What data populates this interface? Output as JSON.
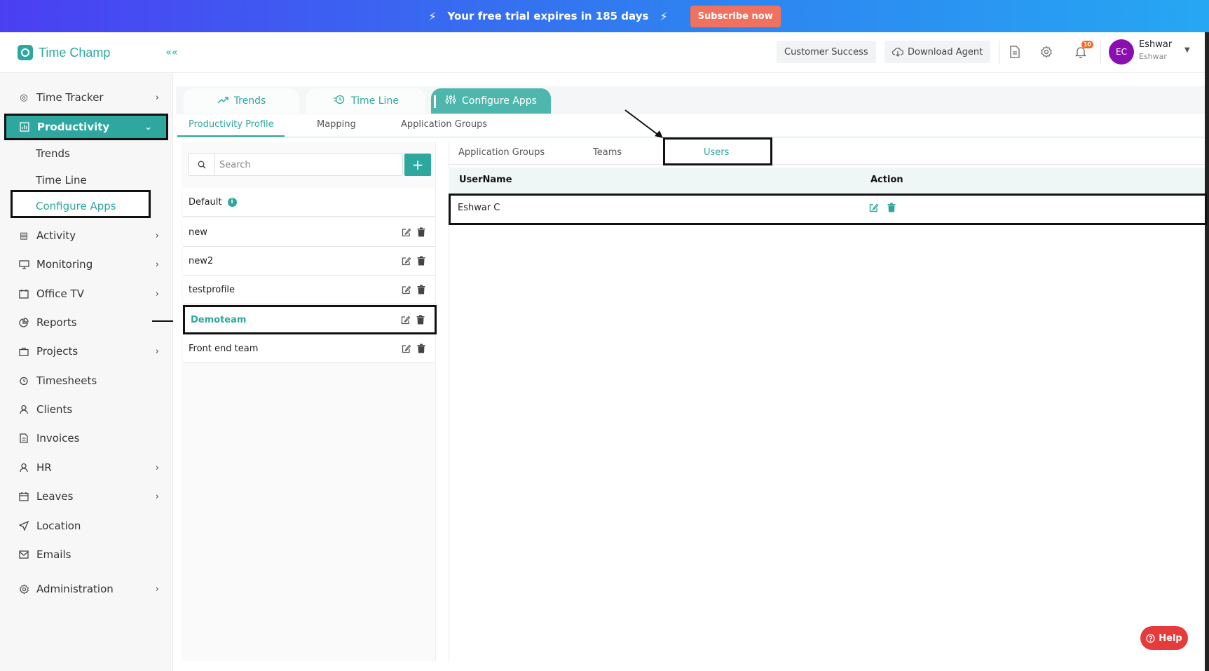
{
  "banner": {
    "trial_text": "Your free trial expires in 185 days",
    "subscribe_label": "Subscribe now"
  },
  "header": {
    "app_name": "Time Champ",
    "customer_success_label": "Customer Success",
    "download_agent_label": "Download Agent",
    "notifications_count": "10",
    "avatar_initials": "EC",
    "user_name": "Eshwar",
    "user_subtitle": "Eshwar"
  },
  "sidebar": {
    "items": [
      {
        "label": "Time Tracker"
      },
      {
        "label": "Productivity"
      },
      {
        "label": "Activity"
      },
      {
        "label": "Monitoring"
      },
      {
        "label": "Office TV"
      },
      {
        "label": "Reports"
      },
      {
        "label": "Projects"
      },
      {
        "label": "Timesheets"
      },
      {
        "label": "Clients"
      },
      {
        "label": "Invoices"
      },
      {
        "label": "HR"
      },
      {
        "label": "Leaves"
      },
      {
        "label": "Location"
      },
      {
        "label": "Emails"
      },
      {
        "label": "Administration"
      }
    ],
    "productivity_sub": [
      {
        "label": "Trends"
      },
      {
        "label": "Time Line"
      },
      {
        "label": "Configure Apps"
      }
    ]
  },
  "main": {
    "top_tabs": [
      {
        "label": "Trends"
      },
      {
        "label": "Time Line"
      },
      {
        "label": "Configure Apps"
      }
    ],
    "sub_tabs": [
      {
        "label": "Productivity Profile"
      },
      {
        "label": "Mapping"
      },
      {
        "label": "Application Groups"
      }
    ],
    "search": {
      "placeholder": "Search",
      "value": ""
    },
    "profiles": [
      {
        "name": "Default"
      },
      {
        "name": "new"
      },
      {
        "name": "new2"
      },
      {
        "name": "testprofile"
      },
      {
        "name": "Demoteam"
      },
      {
        "name": "Front end team"
      }
    ],
    "detail_tabs": [
      {
        "label": "Application Groups"
      },
      {
        "label": "Teams"
      },
      {
        "label": "Users"
      }
    ],
    "table": {
      "columns": [
        "UserName",
        "Action"
      ],
      "rows": [
        {
          "username": "Eshwar C"
        }
      ]
    }
  },
  "help": {
    "label": "Help"
  },
  "colors": {
    "accent": "#2ea79f",
    "banner_start": "#4b3ff2",
    "banner_end": "#26a7f3",
    "subscribe": "#f0715e",
    "help": "#e53b3b",
    "avatar": "#8b0fb0"
  }
}
